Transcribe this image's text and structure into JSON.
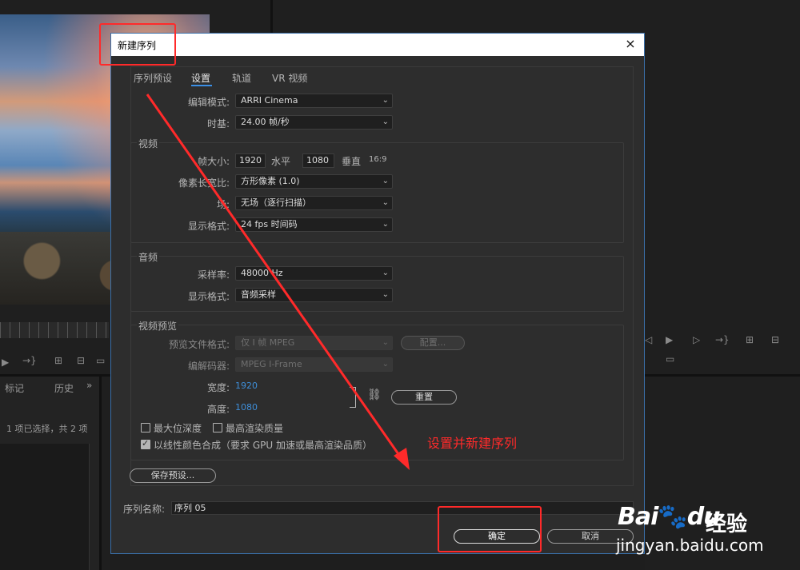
{
  "background": {
    "left_tabs": [
      "标记",
      "历史"
    ],
    "more_icon": "»",
    "selection_status": "1 项已选择，共 2 项"
  },
  "dialog": {
    "title": "新建序列",
    "close_icon": "×",
    "tabs": [
      {
        "label": "序列预设"
      },
      {
        "label": "设置",
        "active": true
      },
      {
        "label": "轨道"
      },
      {
        "label": "VR 视频"
      }
    ],
    "editing_mode": {
      "label": "编辑模式:",
      "value": "ARRI Cinema"
    },
    "timebase": {
      "label": "时基:",
      "value": "24.00  帧/秒"
    },
    "video": {
      "title": "视频",
      "frame_size_label": "帧大小:",
      "width_value": "1920",
      "horizontal_label": "水平",
      "height_value": "1080",
      "vertical_label": "垂直",
      "aspect_ratio": "16:9",
      "pixel_aspect": {
        "label": "像素长宽比:",
        "value": "方形像素 (1.0)"
      },
      "fields": {
        "label": "场:",
        "value": "无场（逐行扫描）"
      },
      "display_format": {
        "label": "显示格式:",
        "value": "24 fps 时间码"
      }
    },
    "audio": {
      "title": "音频",
      "sample_rate": {
        "label": "采样率:",
        "value": "48000 Hz"
      },
      "display_format": {
        "label": "显示格式:",
        "value": "音频采样"
      }
    },
    "video_preview": {
      "title": "视频预览",
      "file_format": {
        "label": "预览文件格式:",
        "value": "仅 I 帧 MPEG"
      },
      "configure_button": "配置...",
      "codec": {
        "label": "编解码器:",
        "value": "MPEG I-Frame"
      },
      "width_label": "宽度:",
      "width_value": "1920",
      "height_label": "高度:",
      "height_value": "1080",
      "reset_button": "重置",
      "max_bit_depth": {
        "label": "最大位深度",
        "checked": false
      },
      "max_render_quality": {
        "label": "最高渲染质量",
        "checked": false
      },
      "linear_color": {
        "label": "以线性颜色合成（要求 GPU 加速或最高渲染品质）",
        "checked": true
      }
    },
    "save_preset_button": "保存预设...",
    "sequence_name_label": "序列名称:",
    "sequence_name_value": "序列 05",
    "ok_button": "确定",
    "cancel_button": "取消"
  },
  "annotation": {
    "text": "设置并新建序列",
    "color": "#ff2a2a"
  },
  "watermark": {
    "brand": "Bai",
    "brand_suffix": "du",
    "product": "经验",
    "url": "jingyan.baidu.com"
  }
}
